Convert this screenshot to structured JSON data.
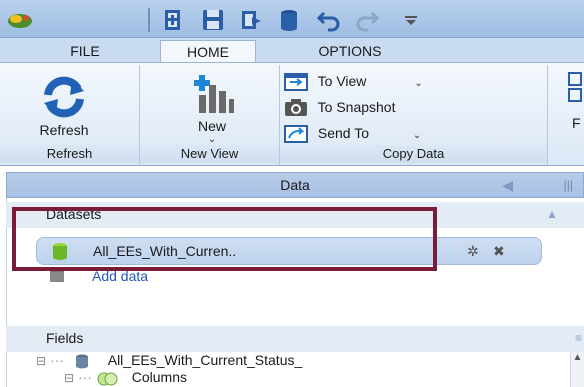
{
  "quick_access": {
    "icons": [
      "app-logo-icon",
      "new-icon",
      "save-icon",
      "open-icon",
      "database-icon",
      "undo-icon",
      "redo-icon",
      "customize-icon"
    ]
  },
  "tabs": [
    {
      "label": "FILE",
      "active": false
    },
    {
      "label": "HOME",
      "active": true
    },
    {
      "label": "OPTIONS",
      "active": false
    }
  ],
  "ribbon": {
    "refresh_group": {
      "button": "Refresh",
      "label": "Refresh"
    },
    "newview_group": {
      "button": "New",
      "caret": "⌄",
      "label": "New View"
    },
    "copydata_group": {
      "items": [
        {
          "label": "To View",
          "has_caret": true
        },
        {
          "label": "To Snapshot",
          "has_caret": false
        },
        {
          "label": "Send To",
          "has_caret": true
        }
      ],
      "label": "Copy Data"
    },
    "partial_group_letter": "F"
  },
  "panel": {
    "title": "Data",
    "datasets_header": "Datasets",
    "dataset_item": "All_EEs_With_Curren..",
    "add_data_link": "Add data",
    "fields_header": "Fields",
    "tree": {
      "root": "All_EEs_With_Current_Status_",
      "child": "Columns"
    }
  },
  "colors": {
    "accent_highlight": "#7a1b3a",
    "ribbon_bg": "#dbe7f5",
    "panel_header": "#a8c0e3"
  }
}
